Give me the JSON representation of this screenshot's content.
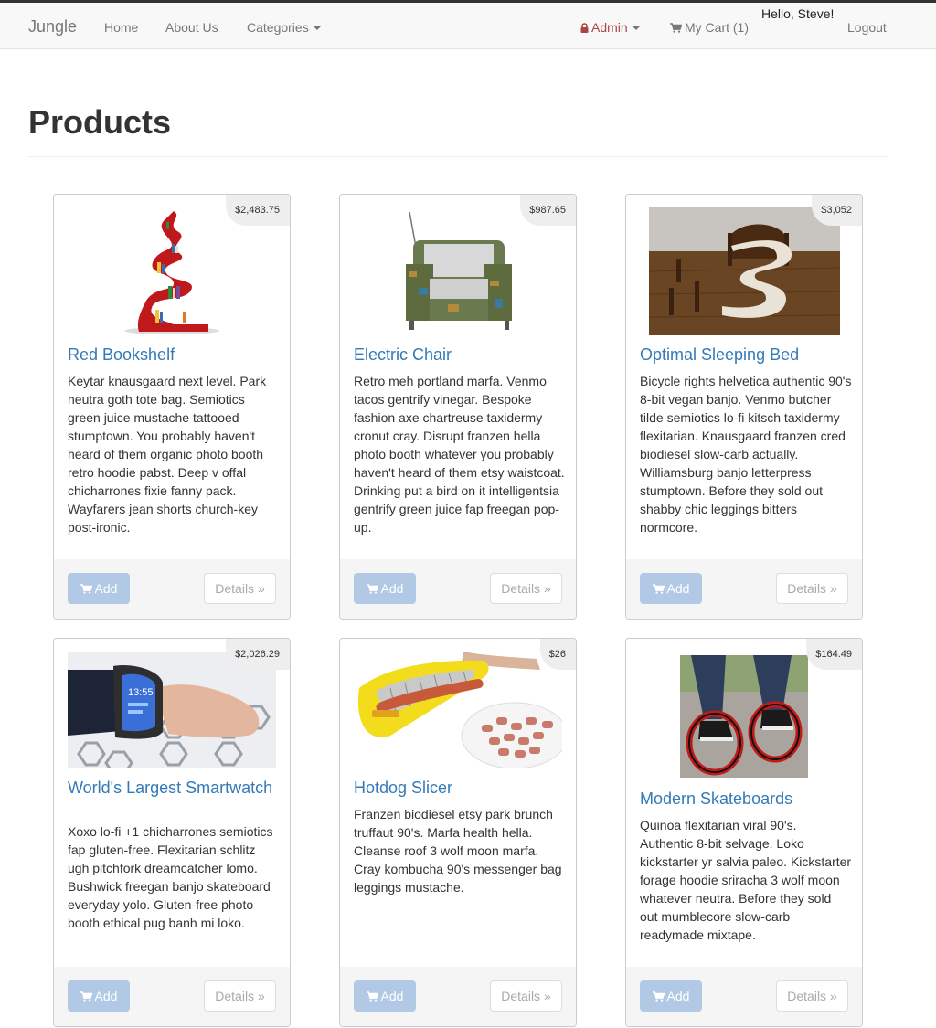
{
  "nav": {
    "brand": "Jungle",
    "home": "Home",
    "about": "About Us",
    "categories": "Categories",
    "admin": "Admin",
    "cart": "My Cart (1)",
    "greeting": "Hello, Steve!",
    "logout": "Logout"
  },
  "page": {
    "title": "Products"
  },
  "buttons": {
    "add": "Add",
    "details": "Details »"
  },
  "products": [
    {
      "name": "Red Bookshelf",
      "price": "$2,483.75",
      "description": "Keytar knausgaard next level. Park neutra goth tote bag. Semiotics green juice mustache tattooed stumptown. You probably haven't heard of them organic photo booth retro hoodie pabst. Deep v offal chicharrones fixie fanny pack. Wayfarers jean shorts church-key post-ironic."
    },
    {
      "name": "Electric Chair",
      "price": "$987.65",
      "description": "Retro meh portland marfa. Venmo tacos gentrify vinegar. Bespoke fashion axe chartreuse taxidermy cronut cray. Disrupt franzen hella photo booth whatever you probably haven't heard of them etsy waistcoat. Drinking put a bird on it intelligentsia gentrify green juice fap freegan pop-up."
    },
    {
      "name": "Optimal Sleeping Bed",
      "price": "$3,052",
      "description": "Bicycle rights helvetica authentic 90's 8-bit vegan banjo. Venmo butcher tilde semiotics lo-fi kitsch taxidermy flexitarian. Knausgaard franzen cred biodiesel slow-carb actually. Williamsburg banjo letterpress stumptown. Before they sold out shabby chic leggings bitters normcore."
    },
    {
      "name": "World's Largest Smartwatch",
      "price": "$2,026.29",
      "description": "Xoxo lo-fi +1 chicharrones semiotics fap gluten-free. Flexitarian schlitz ugh pitchfork dreamcatcher lomo. Bushwick freegan banjo skateboard everyday yolo. Gluten-free photo booth ethical pug banh mi loko."
    },
    {
      "name": "Hotdog Slicer",
      "price": "$26",
      "description": "Franzen biodiesel etsy park brunch truffaut 90's. Marfa health hella. Cleanse roof 3 wolf moon marfa. Cray kombucha 90's messenger bag leggings mustache."
    },
    {
      "name": "Modern Skateboards",
      "price": "$164.49",
      "description": "Quinoa flexitarian viral 90's. Authentic 8-bit selvage. Loko kickstarter yr salvia paleo. Kickstarter forage hoodie sriracha 3 wolf moon whatever neutra. Before they sold out mumblecore slow-carb readymade mixtape."
    }
  ],
  "colors": {
    "link": "#337ab7",
    "admin": "#a94442",
    "add_button": "#b2c9e6"
  },
  "icons": {
    "admin": "lock-icon",
    "cart": "shopping-cart-icon",
    "dropdown": "caret-down-icon"
  }
}
